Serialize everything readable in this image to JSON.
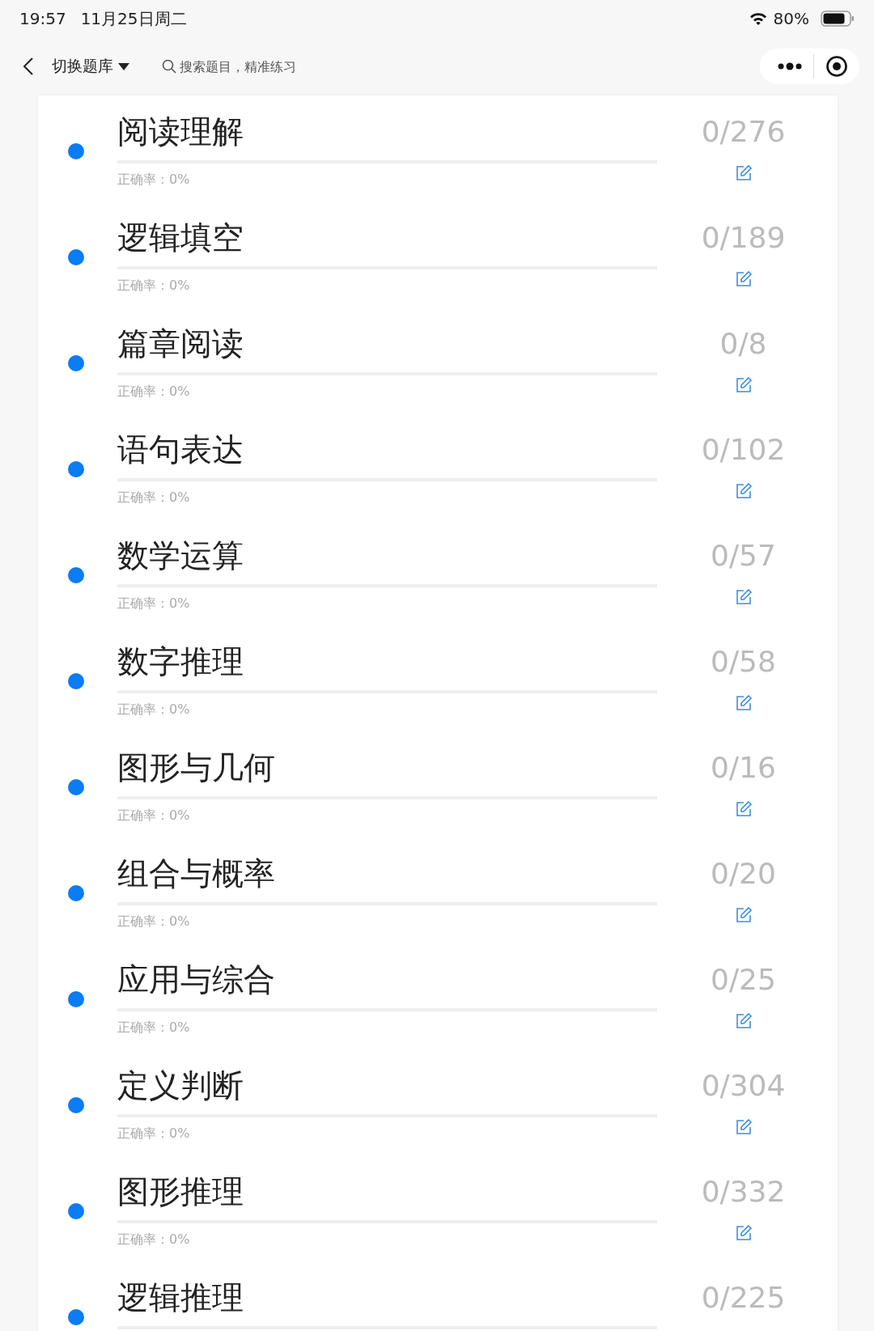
{
  "status_bar": {
    "time": "19:57",
    "date": "11月25日周二",
    "battery": "80%"
  },
  "nav_bar": {
    "switch_label": "切换题库",
    "search": {
      "placeholder": "搜索题目，精准练习"
    }
  },
  "categories": [
    {
      "title": "阅读理解",
      "count": "0/276",
      "level": 0,
      "accuracy": "正确率：0%"
    },
    {
      "title": "逻辑填空",
      "count": "0/189",
      "level": 0,
      "accuracy": "正确率：0%"
    },
    {
      "title": "篇章阅读",
      "count": "0/8",
      "level": 0,
      "accuracy": "正确率：0%"
    },
    {
      "title": "语句表达",
      "count": "0/102",
      "level": 0,
      "accuracy": "正确率：0%"
    },
    {
      "title": "数学运算",
      "count": "0/57",
      "level": 0,
      "accuracy": "正确率：0%"
    },
    {
      "title": "数字推理",
      "count": "0/58",
      "level": 0,
      "accuracy": "正确率：0%"
    },
    {
      "title": "图形与几何",
      "count": "0/16",
      "level": 0,
      "accuracy": "正确率：0%"
    },
    {
      "title": "组合与概率",
      "count": "0/20",
      "level": 0,
      "accuracy": "正确率：0%"
    },
    {
      "title": "应用与综合",
      "count": "0/25",
      "level": 0,
      "accuracy": "正确率：0%"
    },
    {
      "title": "定义判断",
      "count": "0/304",
      "level": 0,
      "accuracy": "正确率：0%"
    },
    {
      "title": "图形推理",
      "count": "0/332",
      "level": 0,
      "accuracy": "正确率：0%"
    },
    {
      "title": "逻辑推理",
      "count": "0/225",
      "level": 0
    }
  ]
}
